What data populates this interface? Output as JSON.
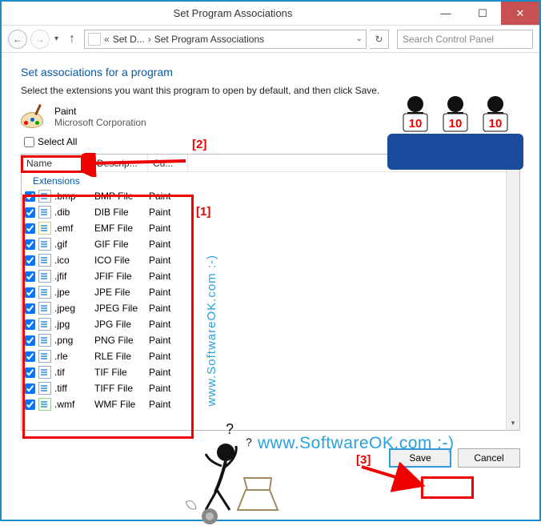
{
  "window": {
    "title": "Set Program Associations"
  },
  "breadcrumb": {
    "a": "Set D...",
    "b": "Set Program Associations"
  },
  "search": {
    "placeholder": "Search Control Panel"
  },
  "heading": "Set associations for a program",
  "instruction": "Select the extensions you want this program to open by default, and then click Save.",
  "program": {
    "name": "Paint",
    "corp": "Microsoft Corporation"
  },
  "selectall": "Select All",
  "columns": {
    "name": "Name",
    "desc": "Descrip...",
    "cur": "Cu..."
  },
  "group": "Extensions",
  "rows": [
    {
      "ext": ".bmp",
      "desc": "BMP File",
      "cur": "Paint"
    },
    {
      "ext": ".dib",
      "desc": "DIB File",
      "cur": "Paint"
    },
    {
      "ext": ".emf",
      "desc": "EMF File",
      "cur": "Paint"
    },
    {
      "ext": ".gif",
      "desc": "GIF File",
      "cur": "Paint"
    },
    {
      "ext": ".ico",
      "desc": "ICO File",
      "cur": "Paint"
    },
    {
      "ext": ".jfif",
      "desc": "JFIF File",
      "cur": "Paint"
    },
    {
      "ext": ".jpe",
      "desc": "JPE File",
      "cur": "Paint"
    },
    {
      "ext": ".jpeg",
      "desc": "JPEG File",
      "cur": "Paint"
    },
    {
      "ext": ".jpg",
      "desc": "JPG File",
      "cur": "Paint"
    },
    {
      "ext": ".png",
      "desc": "PNG File",
      "cur": "Paint"
    },
    {
      "ext": ".rle",
      "desc": "RLE File",
      "cur": "Paint"
    },
    {
      "ext": ".tif",
      "desc": "TIF File",
      "cur": "Paint"
    },
    {
      "ext": ".tiff",
      "desc": "TIFF File",
      "cur": "Paint"
    },
    {
      "ext": ".wmf",
      "desc": "WMF File",
      "cur": "Paint"
    }
  ],
  "buttons": {
    "save": "Save",
    "cancel": "Cancel"
  },
  "annotations": {
    "l1": "[1]",
    "l2": "[2]",
    "l3": "[3]"
  },
  "watermark_v": "www.SoftwareOK.com :-)",
  "watermark_h": "www.SoftwareOK.com :-)",
  "judge_score": "10"
}
